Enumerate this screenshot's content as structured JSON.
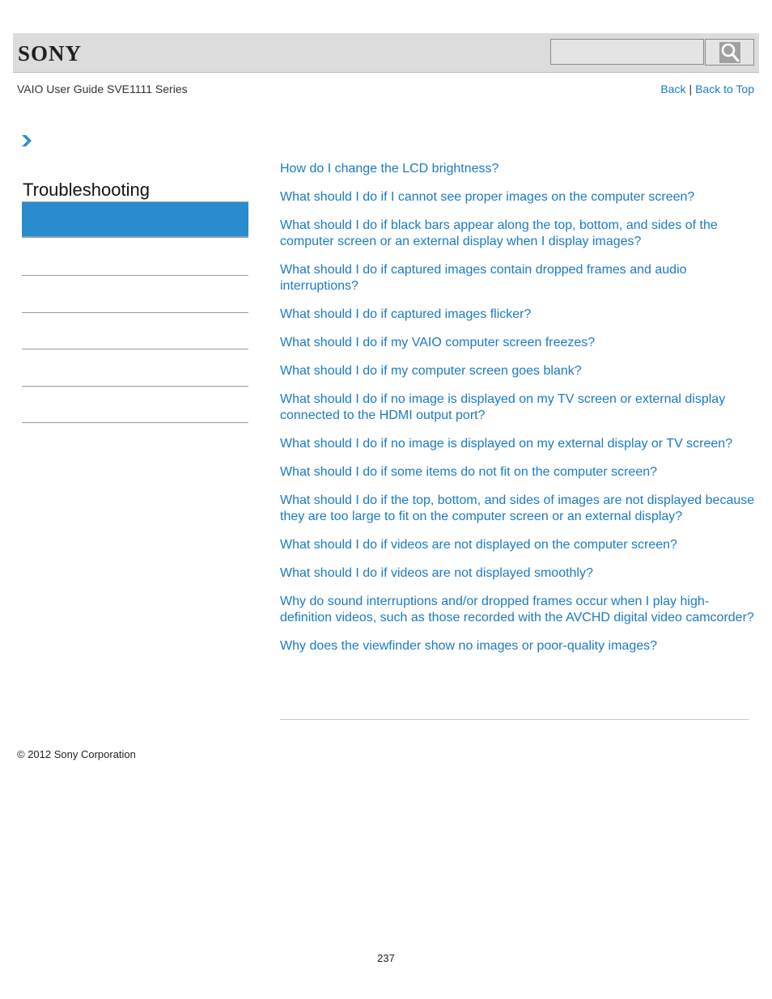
{
  "header": {
    "logo": "SONY",
    "search": {
      "value": "",
      "placeholder": ""
    },
    "search_icon": "magnifier-icon"
  },
  "subheader": {
    "title": "VAIO User Guide SVE1111 Series",
    "back_label": "Back",
    "separator": "|",
    "back_to_top_label": "Back to Top"
  },
  "sidebar": {
    "breadcrumb_icon": "chevron-right-icon",
    "title": "Troubleshooting",
    "items": [
      {
        "label": "",
        "active": true
      },
      {
        "label": "",
        "active": false
      },
      {
        "label": "",
        "active": false
      },
      {
        "label": "",
        "active": false
      },
      {
        "label": "",
        "active": false
      },
      {
        "label": "",
        "active": false
      }
    ]
  },
  "main": {
    "links": [
      "How do I change the LCD brightness?",
      "What should I do if I cannot see proper images on the computer screen?",
      "What should I do if black bars appear along the top, bottom, and sides of the computer screen or an external display when I display images?",
      "What should I do if captured images contain dropped frames and audio interruptions?",
      "What should I do if captured images flicker?",
      "What should I do if my VAIO computer screen freezes?",
      "What should I do if my computer screen goes blank?",
      "What should I do if no image is displayed on my TV screen or external display connected to the HDMI output port?",
      "What should I do if no image is displayed on my external display or TV screen?",
      "What should I do if some items do not fit on the computer screen?",
      "What should I do if the top, bottom, and sides of images are not displayed because they are too large to fit on the computer screen or an external display?",
      "What should I do if videos are not displayed on the computer screen?",
      "What should I do if videos are not displayed smoothly?",
      "Why do sound interruptions and/or dropped frames occur when I play high-definition videos, such as those recorded with the AVCHD digital video camcorder?",
      "Why does the viewfinder show no images or poor-quality images?"
    ]
  },
  "footer": {
    "copyright": "© 2012 Sony Corporation",
    "page_number": "237"
  },
  "colors": {
    "link": "#1a7ac4",
    "active_nav": "#2a8ccf",
    "header_bg": "#dcdcdc"
  }
}
